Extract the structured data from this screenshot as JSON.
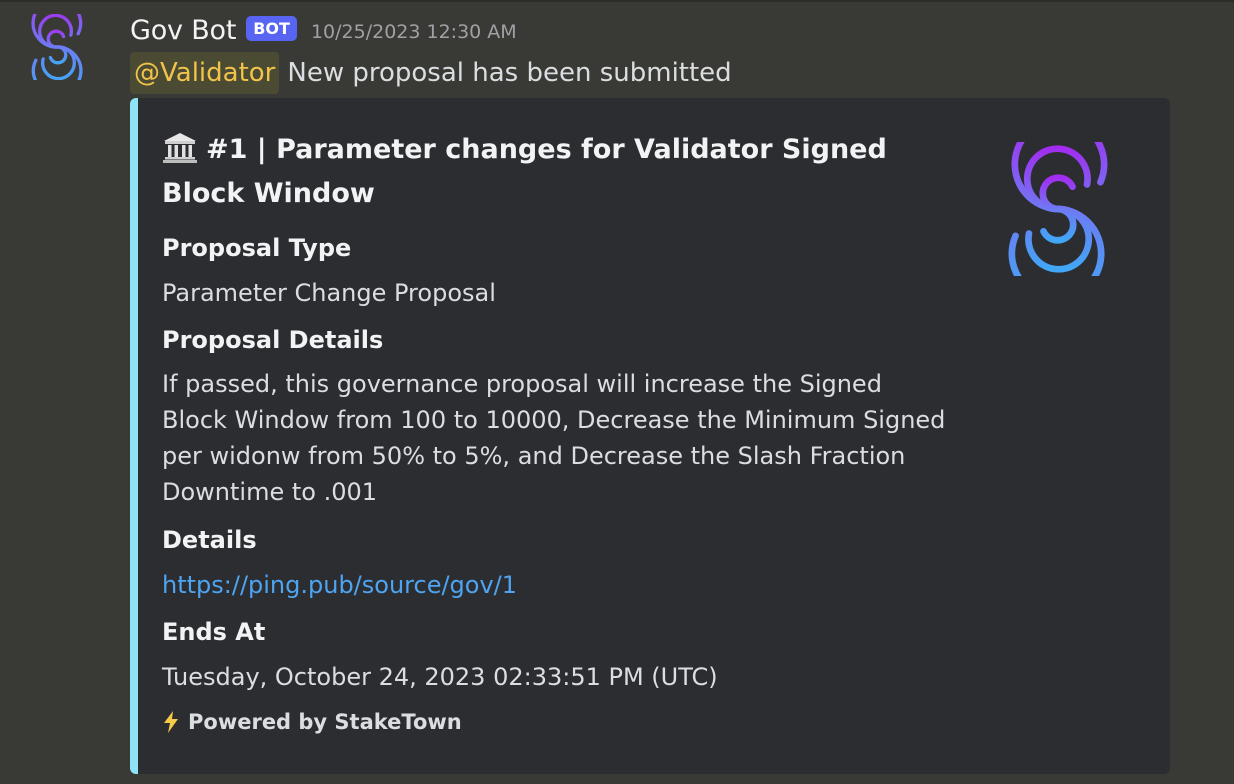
{
  "message": {
    "username": "Gov Bot",
    "badge": "BOT",
    "timestamp": "10/25/2023 12:30 AM",
    "mention": "@Validator",
    "text": "New proposal has been submitted"
  },
  "embed": {
    "title": "#1 | Parameter changes for Validator Signed Block Window",
    "title_icon": "classical-building-icon",
    "thumbnail_icon": "staketown-logo",
    "accent_color": "#8fe3f6",
    "fields": [
      {
        "name": "Proposal Type",
        "value": "Parameter Change Proposal"
      },
      {
        "name": "Proposal Details",
        "value": "If passed, this governance proposal will increase the Signed Block Window from 100 to 10000, Decrease the Minimum Signed per widonw from 50% to 5%, and Decrease the Slash Fraction Downtime to .001"
      },
      {
        "name": "Details",
        "value": "https://ping.pub/source/gov/1"
      },
      {
        "name": "Ends At",
        "value": "Tuesday, October 24, 2023 02:33:51 PM (UTC)"
      }
    ],
    "footer": "Powered by StakeTown",
    "footer_icon": "lightning-icon"
  },
  "colors": {
    "background": "#393a35",
    "embed_background": "#2b2d31",
    "badge": "#5865f2",
    "mention_text": "#f0c34a",
    "link": "#4ea4f0"
  }
}
